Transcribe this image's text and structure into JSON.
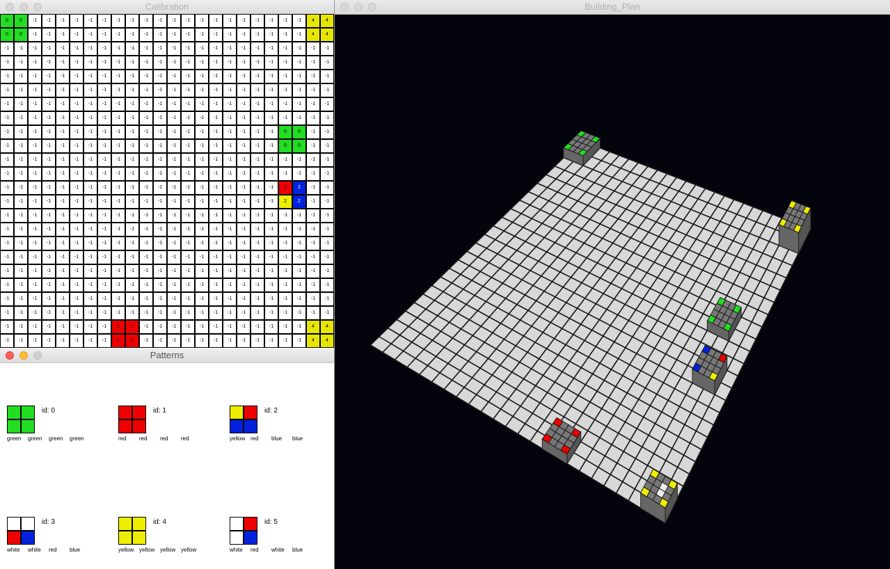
{
  "calibration": {
    "title": "Calibration",
    "cell_default_value": "-1",
    "cols": 24,
    "rows": 24,
    "marked_cells": [
      {
        "row": 0,
        "col": 0,
        "value": "0",
        "color": "#22dd22"
      },
      {
        "row": 0,
        "col": 1,
        "value": "0",
        "color": "#22dd22"
      },
      {
        "row": 1,
        "col": 0,
        "value": "0",
        "color": "#22dd22"
      },
      {
        "row": 1,
        "col": 1,
        "value": "0",
        "color": "#22dd22"
      },
      {
        "row": 0,
        "col": 22,
        "value": "4",
        "color": "#e6e600"
      },
      {
        "row": 0,
        "col": 23,
        "value": "4",
        "color": "#e6e600"
      },
      {
        "row": 1,
        "col": 22,
        "value": "4",
        "color": "#e6e600"
      },
      {
        "row": 1,
        "col": 23,
        "value": "4",
        "color": "#e6e600"
      },
      {
        "row": 8,
        "col": 20,
        "value": "0",
        "color": "#22dd22"
      },
      {
        "row": 8,
        "col": 21,
        "value": "0",
        "color": "#22dd22"
      },
      {
        "row": 9,
        "col": 20,
        "value": "0",
        "color": "#22dd22"
      },
      {
        "row": 9,
        "col": 21,
        "value": "0",
        "color": "#22dd22"
      },
      {
        "row": 12,
        "col": 20,
        "value": "2",
        "color": "#ee0000"
      },
      {
        "row": 12,
        "col": 21,
        "value": "2",
        "color": "#0022dd"
      },
      {
        "row": 13,
        "col": 20,
        "value": "2",
        "color": "#eeee00"
      },
      {
        "row": 13,
        "col": 21,
        "value": "2",
        "color": "#0022dd"
      },
      {
        "row": 22,
        "col": 8,
        "value": "1",
        "color": "#ee0000"
      },
      {
        "row": 22,
        "col": 9,
        "value": "1",
        "color": "#ee0000"
      },
      {
        "row": 23,
        "col": 8,
        "value": "1",
        "color": "#ee0000"
      },
      {
        "row": 23,
        "col": 9,
        "value": "1",
        "color": "#ee0000"
      },
      {
        "row": 22,
        "col": 22,
        "value": "4",
        "color": "#e6e600"
      },
      {
        "row": 22,
        "col": 23,
        "value": "4",
        "color": "#e6e600"
      },
      {
        "row": 23,
        "col": 22,
        "value": "4",
        "color": "#e6e600"
      },
      {
        "row": 23,
        "col": 23,
        "value": "4",
        "color": "#e6e600"
      }
    ]
  },
  "patterns": {
    "title": "Patterns",
    "items": [
      {
        "id_label": "id:  0",
        "labels": [
          "green",
          "green",
          "green",
          "green"
        ],
        "colors": [
          "#22dd22",
          "#22dd22",
          "#22dd22",
          "#22dd22"
        ]
      },
      {
        "id_label": "id:  1",
        "labels": [
          "red",
          "red",
          "red",
          "red"
        ],
        "colors": [
          "#ee0000",
          "#ee0000",
          "#ee0000",
          "#ee0000"
        ]
      },
      {
        "id_label": "id:  2",
        "labels": [
          "yellow",
          "red",
          "blue",
          "blue"
        ],
        "colors": [
          "#eeee00",
          "#ee0000",
          "#0022dd",
          "#0022dd"
        ]
      },
      {
        "id_label": "id:  3",
        "labels": [
          "white",
          "white",
          "red",
          "blue"
        ],
        "colors": [
          "#ffffff",
          "#ffffff",
          "#ee0000",
          "#0022dd"
        ]
      },
      {
        "id_label": "id:  4",
        "labels": [
          "yellow",
          "yellow",
          "yellow",
          "yellow"
        ],
        "colors": [
          "#eeee00",
          "#eeee00",
          "#eeee00",
          "#eeee00"
        ]
      },
      {
        "id_label": "id:  5",
        "labels": [
          "white",
          "red",
          "white",
          "blue"
        ],
        "colors": [
          "#ffffff",
          "#ee0000",
          "#ffffff",
          "#0022dd"
        ]
      }
    ]
  },
  "plan": {
    "title": "Building_Plan",
    "background": "#04040c",
    "floor_color": "#d8d8d8",
    "grid_line_color": "#141414",
    "block_color": "#777777",
    "colors": {
      "green": "#22dd22",
      "red": "#ee0000",
      "yellow": "#eeee00",
      "blue": "#0022dd",
      "white": "#eeeeee"
    }
  }
}
